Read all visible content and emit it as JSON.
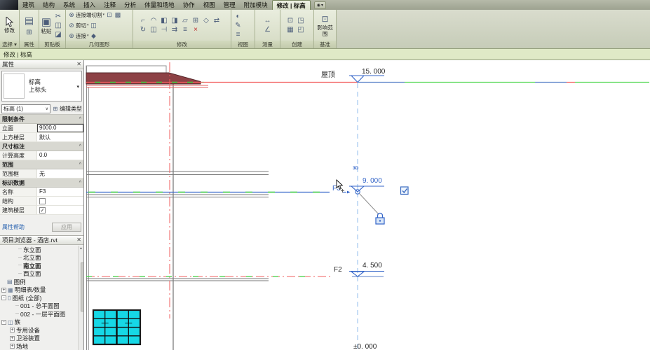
{
  "ribbon": {
    "tabs": [
      "建筑",
      "结构",
      "系统",
      "插入",
      "注释",
      "分析",
      "体量和场地",
      "协作",
      "视图",
      "管理",
      "附加模块"
    ],
    "active_tab": "修改 | 标高",
    "panels": {
      "select": {
        "label": "选择 ▾",
        "modify": "修改"
      },
      "properties": {
        "label": "属性"
      },
      "clipboard": {
        "label": "剪贴板",
        "paste": "粘贴"
      },
      "geometry": {
        "label": "几何图形",
        "rows": [
          {
            "name": "cope-icon",
            "glyph": "⊗",
            "label": "连接端切割",
            "extras": [
              "⊡",
              "▩"
            ]
          },
          {
            "name": "cut-geometry-icon",
            "glyph": "⊘",
            "label": "剪切",
            "extras": [
              "◫"
            ]
          },
          {
            "name": "join-geometry-icon",
            "glyph": "⊕",
            "label": "连接",
            "extras": [
              "◆"
            ]
          }
        ]
      },
      "modify": {
        "label": "修改",
        "icons": [
          {
            "name": "align-icon",
            "glyph": "⌐"
          },
          {
            "name": "offset-icon",
            "glyph": "◠"
          },
          {
            "name": "mirror-pick-icon",
            "glyph": "◧"
          },
          {
            "name": "mirror-draw-icon",
            "glyph": "◨"
          },
          {
            "name": "split-icon",
            "glyph": "▱"
          },
          {
            "name": "array-icon",
            "glyph": "⊞"
          },
          {
            "name": "scale-icon",
            "glyph": "◇"
          },
          {
            "name": "move-icon",
            "glyph": "⇄"
          },
          {
            "name": "rotate-icon",
            "glyph": "↻"
          },
          {
            "name": "copy-icon",
            "glyph": "◫"
          },
          {
            "name": "trim-icon",
            "glyph": "⊣"
          },
          {
            "name": "pin-icon",
            "glyph": "⇉"
          },
          {
            "name": "unpin-icon",
            "glyph": "≡"
          },
          {
            "name": "delete-icon",
            "glyph": "×",
            "color": "#c03030"
          }
        ]
      },
      "view": {
        "label": "视图",
        "icons": [
          {
            "name": "thin-lines-icon",
            "glyph": "◐"
          },
          {
            "name": "visibility-icon",
            "glyph": "✎"
          },
          {
            "name": "graphics-icon",
            "glyph": "≡"
          }
        ]
      },
      "measure": {
        "label": "测量",
        "icons": [
          {
            "name": "measure-length-icon",
            "glyph": "↔"
          },
          {
            "name": "measure-angle-icon",
            "glyph": "∠"
          }
        ]
      },
      "create": {
        "label": "创建",
        "icons": [
          {
            "name": "create-group-icon",
            "glyph": "⊡"
          },
          {
            "name": "create-similar-icon",
            "glyph": "◳"
          },
          {
            "name": "legend-component-icon",
            "glyph": "▦"
          },
          {
            "name": "insert-views-icon",
            "glyph": "◰"
          }
        ]
      },
      "datum": {
        "label": "基准",
        "scope_button": "影响范围"
      }
    }
  },
  "options_bar": {
    "text": "修改 | 标高"
  },
  "properties_panel": {
    "title": "属性",
    "type_line1": "标高",
    "type_line2": "上标头",
    "type_selector": "标高 (1)",
    "edit_type": "编辑类型",
    "sections": [
      {
        "header": "限制条件",
        "rows": [
          {
            "label": "立面",
            "value": "9000.0",
            "editing": true
          },
          {
            "label": "上方楼层",
            "value": "默认"
          }
        ]
      },
      {
        "header": "尺寸标注",
        "rows": [
          {
            "label": "计算高度",
            "value": "0.0"
          }
        ]
      },
      {
        "header": "范围",
        "rows": [
          {
            "label": "范围框",
            "value": "无"
          }
        ]
      },
      {
        "header": "标识数据",
        "rows": [
          {
            "label": "名称",
            "value": "F3"
          },
          {
            "label": "结构",
            "checkbox": false
          },
          {
            "label": "建筑楼层",
            "checkbox": true
          }
        ]
      }
    ],
    "help_link": "属性帮助",
    "apply_button": "应用"
  },
  "project_browser": {
    "title": "项目浏览器 - 酒店.rvt",
    "icon_glyphs": {
      "legend": "▤",
      "schedule": "▦",
      "sheet": "▯",
      "family": "◫"
    },
    "items": [
      {
        "label": "东立面",
        "indent": 26,
        "dash": true
      },
      {
        "label": "北立面",
        "indent": 26,
        "dash": true
      },
      {
        "label": "南立面",
        "indent": 26,
        "dash": true,
        "active": true
      },
      {
        "label": "西立面",
        "indent": 26,
        "dash": true
      },
      {
        "label": "图例",
        "indent": 10,
        "icon": "legend"
      },
      {
        "label": "明细表/数量",
        "indent": 2,
        "expand": "+",
        "icon": "schedule"
      },
      {
        "label": "图纸 (全部)",
        "indent": 2,
        "expand": "-",
        "icon": "sheet"
      },
      {
        "label": "001 - 总平面图",
        "indent": 22,
        "dash": true
      },
      {
        "label": "002 - 一层平面图",
        "indent": 22,
        "dash": true
      },
      {
        "label": "族",
        "indent": 2,
        "expand": "-",
        "icon": "family"
      },
      {
        "label": "专用设备",
        "indent": 14,
        "expand": "+"
      },
      {
        "label": "卫浴装置",
        "indent": 14,
        "expand": "+"
      },
      {
        "label": "场地",
        "indent": 14,
        "expand": "+"
      }
    ]
  },
  "drawing": {
    "levels": [
      {
        "name": "屋顶",
        "value": "15. 000"
      },
      {
        "name": "F3",
        "value": "9. 000"
      },
      {
        "name": "F2",
        "value": "4. 500"
      },
      {
        "name": "",
        "value": "±0. 000"
      }
    ],
    "badge_3d": "3D"
  },
  "colors": {
    "selection_blue": "#3465c8",
    "level_red": "#f25c5c",
    "dash_green": "#3fcf3f",
    "roof_fill": "#8d4145",
    "window_cyan": "#16d8e6",
    "ribbon_green": "#dfe9c6"
  }
}
